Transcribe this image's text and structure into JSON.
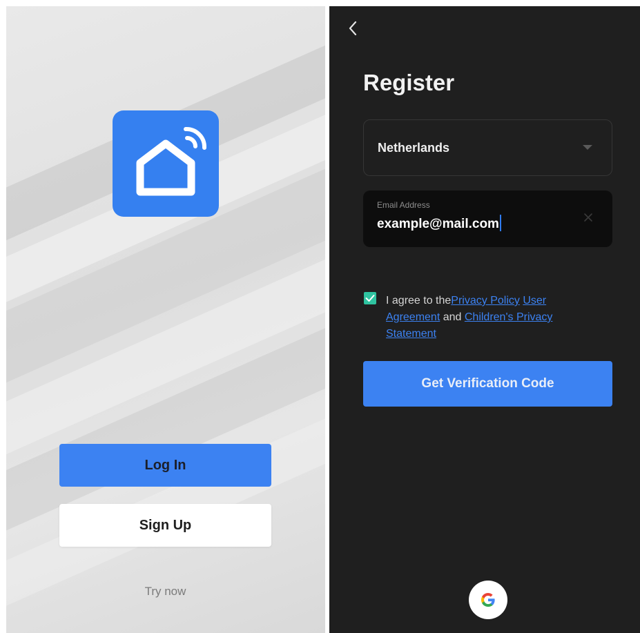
{
  "left_screen": {
    "login_label": "Log In",
    "signup_label": "Sign Up",
    "try_now_label": "Try now",
    "logo_icon": "smart-home-wifi-icon",
    "colors": {
      "logo_bg": "#3580f0",
      "primary_button": "#3c82f2",
      "secondary_button": "#ffffff"
    }
  },
  "right_screen": {
    "back_icon": "chevron-left-icon",
    "title": "Register",
    "country": {
      "value": "Netherlands",
      "icon": "caret-down-icon"
    },
    "email": {
      "label": "Email Address",
      "value": "example@mail.com",
      "clear_icon": "close-icon"
    },
    "agreement": {
      "checked": true,
      "prefix": "I agree to the",
      "privacy_policy": "Privacy Policy",
      "user_agreement": "User Agreement",
      "and": " and ",
      "childrens_privacy": "Children's Privacy Statement"
    },
    "verify_button": "Get Verification Code",
    "google_icon": "google-icon",
    "colors": {
      "background": "#1f1f1f",
      "accent": "#3c82f2",
      "checkbox": "#2fc3a0"
    }
  }
}
